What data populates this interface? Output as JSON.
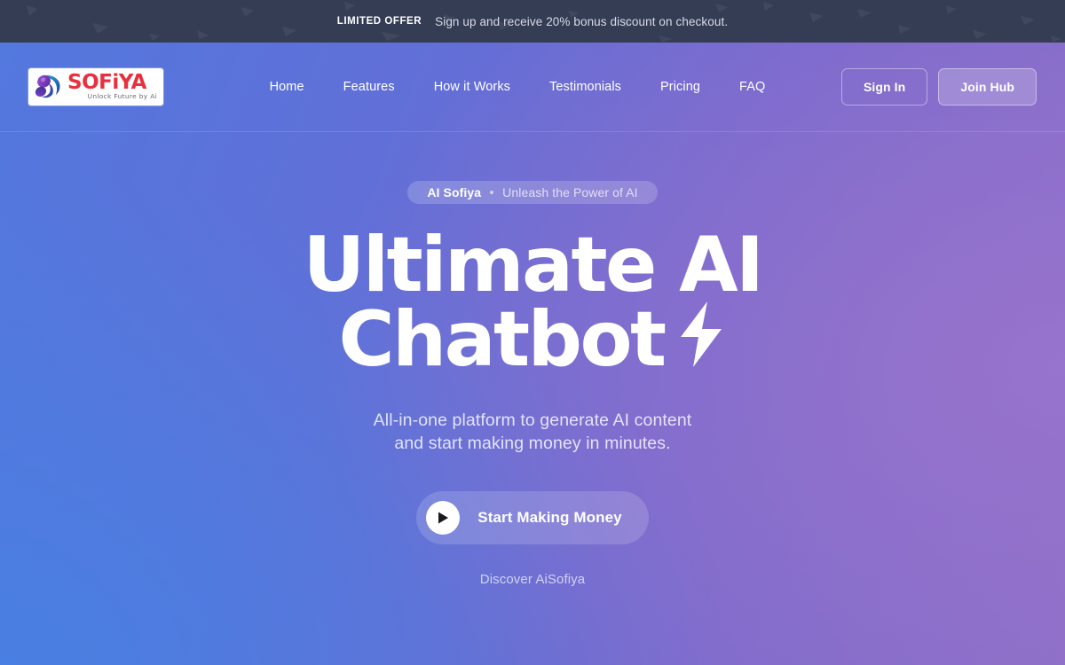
{
  "announcement": {
    "label": "LIMITED OFFER",
    "text": "Sign up and receive 20% bonus discount on checkout."
  },
  "header": {
    "logo": {
      "name": "SOFiYA",
      "tagline": "Unlock Future by Ai",
      "icon": "swirl-orbit-icon"
    },
    "nav": [
      {
        "label": "Home"
      },
      {
        "label": "Features"
      },
      {
        "label": "How it Works"
      },
      {
        "label": "Testimonials"
      },
      {
        "label": "Pricing"
      },
      {
        "label": "FAQ"
      }
    ],
    "sign_in_label": "Sign In",
    "join_label": "Join Hub"
  },
  "hero": {
    "badge_strong": "AI Sofiya",
    "badge_separator": "•",
    "badge_light": "Unleash the Power of AI",
    "headline_line1": "Ultimate AI",
    "headline_line2": "Chatbot",
    "headline_icon": "lightning-bolt-icon",
    "subtitle_line1": "All-in-one platform to generate AI content",
    "subtitle_line2": "and start making money in minutes.",
    "cta_label": "Start Making Money",
    "cta_icon": "play-icon",
    "discover_label": "Discover AiSofiya"
  },
  "colors": {
    "announcement_bg": "#353d55",
    "gradient_left": "#5278de",
    "gradient_right": "#8a6dc6",
    "logo_red": "#e8303f",
    "text_white": "#ffffff"
  }
}
